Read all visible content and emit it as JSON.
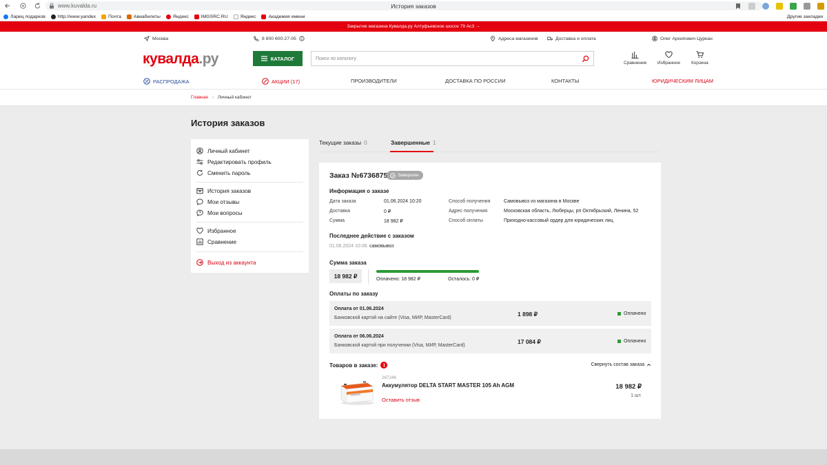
{
  "browser": {
    "url": "www.kuvalda.ru",
    "tab_title": "История заказов",
    "bookmarks": [
      "Ларец подарков",
      "http://www.yandex",
      "Почта",
      "Авиабилеты",
      "Яндекс",
      "IMGSRC.RU",
      "Яндекс",
      "Академия имени"
    ],
    "bookmarks_other": "Другие закладки"
  },
  "promo": {
    "text": "Закрытие магазина Кувалда.ру Алтуфьевское шоссе 79 Ас3"
  },
  "header": {
    "city": "Москва",
    "phone": "8 800 600-27-05",
    "stores": "Адреса магазинов",
    "delivery": "Доставка и оплата",
    "user": "Олег Архипович Цуркан",
    "logo_main": "кувалда",
    "logo_suffix": ".ру",
    "catalog": "КАТАЛОГ",
    "search_placeholder": "Поиск по каталогу",
    "compare": "Сравнение",
    "favorites": "Избранное",
    "cart": "Корзина"
  },
  "menu": {
    "sale": "РАСПРОДАЖА",
    "promotions": "АКЦИИ (17)",
    "producers": "ПРОИЗВОДИТЕЛИ",
    "delivery_russia": "ДОСТАВКА ПО РОССИИ",
    "contacts": "КОНТАКТЫ",
    "legal": "ЮРИДИЧЕСКИМ ЛИЦАМ"
  },
  "breadcrumb": {
    "home": "Главная",
    "current": "Личный кабинет"
  },
  "page": {
    "title": "История заказов"
  },
  "sidebar": {
    "items": [
      {
        "label": "Личный кабинет",
        "icon": "user-icon"
      },
      {
        "label": "Редактировать профиль",
        "icon": "sliders-icon"
      },
      {
        "label": "Сменить пароль",
        "icon": "refresh-icon"
      },
      {
        "label": "История заказов",
        "icon": "box-icon"
      },
      {
        "label": "Мои отзывы",
        "icon": "chat-icon"
      },
      {
        "label": "Мои вопросы",
        "icon": "question-icon"
      },
      {
        "label": "Избранное",
        "icon": "heart-icon"
      },
      {
        "label": "Сравнение",
        "icon": "chart-icon"
      }
    ],
    "logout": "Выход из аккаунта"
  },
  "tabs": {
    "current_label": "Текущие заказы",
    "current_count": "0",
    "completed_label": "Завершенные",
    "completed_count": "1"
  },
  "order": {
    "title": "Заказ №67368757",
    "status": "Завершен",
    "info_heading": "Информация о заказе",
    "date_label": "Дата заказа",
    "date_value": "01.06.2024 10:20",
    "delivery_label": "Доставка",
    "delivery_value": "0 ₽",
    "sum_label": "Сумма",
    "sum_value": "18 982 ₽",
    "receive_method_label": "Способ получения",
    "receive_method_value": "Самовывоз из магазина в Москве",
    "receive_address_label": "Адрес получения",
    "receive_address_value": "Московская область, Люберцы, рп Октябрьский, Ленина, 52",
    "payment_method_label": "Способ оплаты",
    "payment_method_value": "Приходно-кассовый ордер для юридических лиц",
    "last_action_heading": "Последнее действие с заказом",
    "last_action_date": "01.06.2024 10:08.",
    "last_action_text": "самовывоз",
    "total_heading": "Сумма заказа",
    "total_value": "18 982 ₽",
    "paid_fraction": 1.0,
    "paid_text": "Оплачено: 18 982 ₽",
    "left_text": "Осталось: 0 ₽",
    "payments_heading": "Оплаты по заказу",
    "payments": [
      {
        "title": "Оплата от 01.06.2024",
        "method": "Банковской картой на сайте (Visa, МИР, MasterCard)",
        "amount": "1 898 ₽",
        "status": "Оплачено"
      },
      {
        "title": "Оплата от 06.06.2024",
        "method": "Банковской картой при получении (Visa, МИР, MasterCard)",
        "amount": "17 084 ₽",
        "status": "Оплачено"
      }
    ],
    "goods_heading": "Товаров в заказе:",
    "goods_count": "1",
    "collapse_label": "Свернуть состав заказа",
    "product": {
      "sku": "267246",
      "name": "Аккумулятор DELTA START MASTER 105 Ah AGM",
      "review": "Оставить отзыв",
      "price": "18 982 ₽",
      "qty": "1 шт."
    }
  },
  "colors": {
    "brand_red": "#e3000f",
    "brand_green": "#1f7a3a",
    "paid_green": "#2a9a35"
  }
}
